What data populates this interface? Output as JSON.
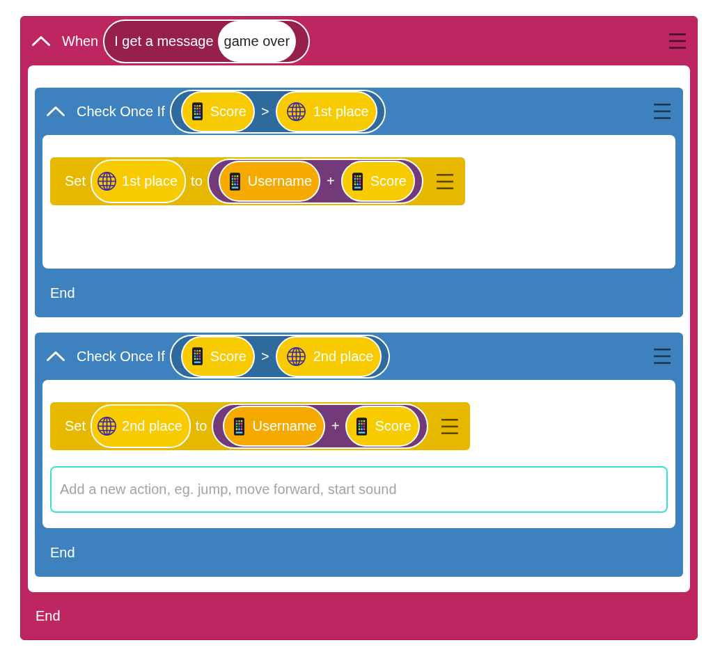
{
  "when_block": {
    "expanded": true,
    "keyword": "When",
    "trigger": {
      "label": "I get a message",
      "value": "game over"
    },
    "children": [
      {
        "kind": "check",
        "expanded": true,
        "keyword": "Check Once If",
        "condition": {
          "operator": ">",
          "operands": [
            {
              "kind": "device",
              "label": "Score"
            },
            {
              "kind": "global",
              "label": "1st place"
            }
          ]
        },
        "actions": [
          {
            "kind": "set",
            "keyword": "Set",
            "target": {
              "kind": "global",
              "label": "1st place"
            },
            "connector": "to",
            "value": {
              "operator": "+",
              "operands": [
                {
                  "kind": "device",
                  "label": "Username",
                  "color": "#f6aa00"
                },
                {
                  "kind": "device",
                  "label": "Score",
                  "color": "#f8ca00"
                }
              ]
            }
          }
        ],
        "end_label": "End"
      },
      {
        "kind": "check",
        "expanded": true,
        "keyword": "Check Once If",
        "condition": {
          "operator": ">",
          "operands": [
            {
              "kind": "device",
              "label": "Score"
            },
            {
              "kind": "global",
              "label": "2nd place"
            }
          ]
        },
        "actions": [
          {
            "kind": "set",
            "keyword": "Set",
            "target": {
              "kind": "global",
              "label": "2nd place"
            },
            "connector": "to",
            "value": {
              "operator": "+",
              "operands": [
                {
                  "kind": "device",
                  "label": "Username",
                  "color": "#f6aa00"
                },
                {
                  "kind": "device",
                  "label": "Score",
                  "color": "#f8ca00"
                }
              ]
            }
          }
        ],
        "new_action": {
          "placeholder": "Add a new action, eg. jump, move forward, start sound"
        },
        "end_label": "End"
      }
    ],
    "end_label": "End"
  }
}
